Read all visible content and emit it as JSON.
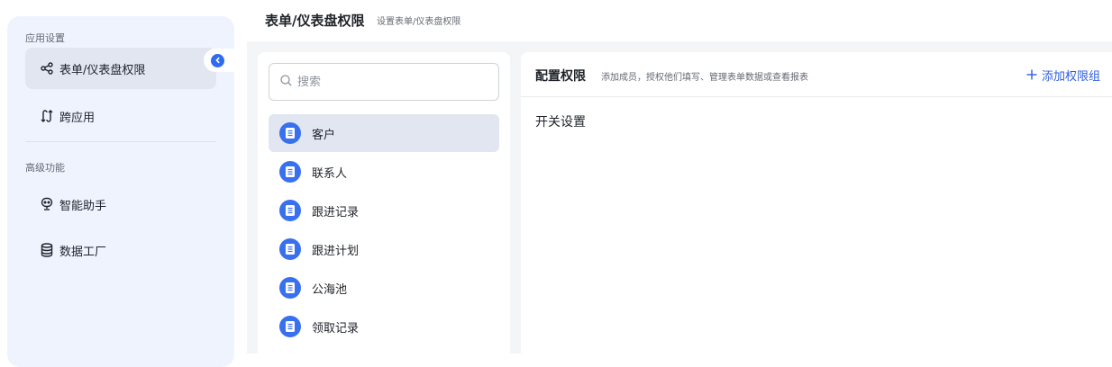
{
  "header": {
    "title": "表单/仪表盘权限",
    "subtitle": "设置表单/仪表盘权限"
  },
  "sidebar": {
    "groups": [
      {
        "title": "应用设置",
        "items": [
          {
            "label": "表单/仪表盘权限",
            "icon": "share-nodes-icon",
            "active": true
          },
          {
            "label": "跨应用",
            "icon": "cross-app-icon",
            "active": false
          }
        ]
      },
      {
        "title": "高级功能",
        "items": [
          {
            "label": "智能助手",
            "icon": "robot-icon",
            "active": false
          },
          {
            "label": "数据工厂",
            "icon": "database-icon",
            "active": false
          }
        ]
      }
    ]
  },
  "search": {
    "placeholder": "搜索"
  },
  "forms": [
    {
      "label": "客户",
      "active": true
    },
    {
      "label": "联系人",
      "active": false
    },
    {
      "label": "跟进记录",
      "active": false
    },
    {
      "label": "跟进计划",
      "active": false
    },
    {
      "label": "公海池",
      "active": false
    },
    {
      "label": "领取记录",
      "active": false
    }
  ],
  "permission": {
    "title": "配置权限",
    "description": "添加成员，授权他们填写、管理表单数据或查看报表",
    "add_label": "添加权限组",
    "section_title": "开关设置"
  },
  "colors": {
    "accent": "#2f6bf1",
    "sidebar_bg": "#eef3fd",
    "active_bg": "#e1e6f0",
    "form_icon": "#3970ee"
  }
}
